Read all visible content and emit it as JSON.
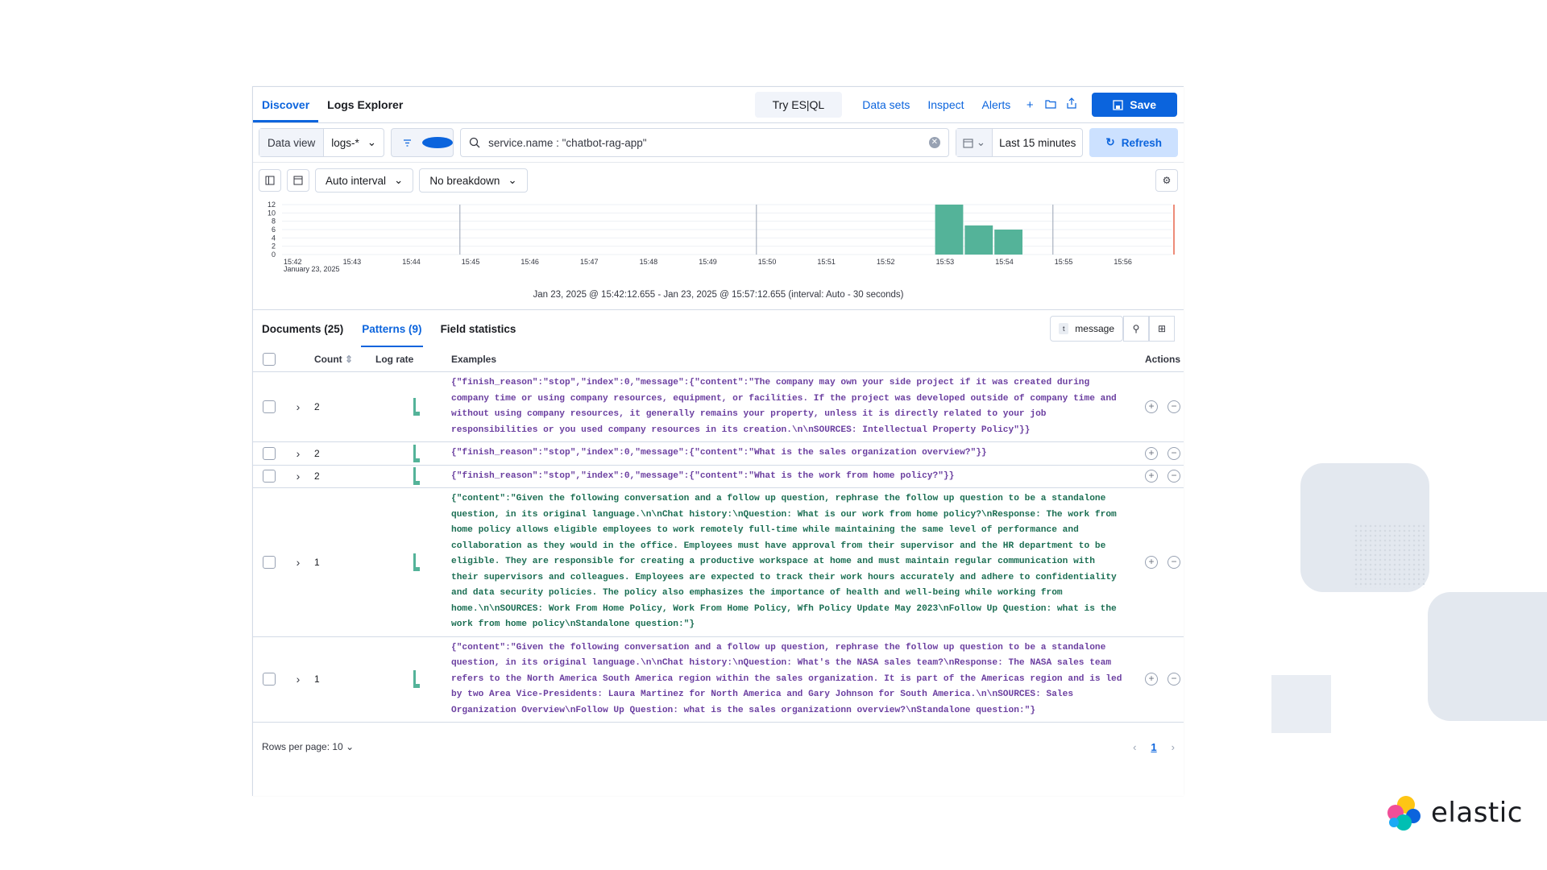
{
  "tabs": [
    {
      "label": "Discover",
      "active": true
    },
    {
      "label": "Logs Explorer",
      "active": false
    }
  ],
  "toolbar": {
    "try_esql": "Try ES|QL",
    "data_sets": "Data sets",
    "inspect": "Inspect",
    "alerts": "Alerts",
    "save": "Save",
    "icons": [
      "plus-icon",
      "folder-icon",
      "share-icon",
      "save-icon"
    ]
  },
  "query": {
    "data_view_label": "Data view",
    "data_view_value": "logs-*",
    "text": "service.name : \"chatbot-rag-app\"",
    "time_range": "Last 15 minutes",
    "refresh": "Refresh"
  },
  "chart_controls": {
    "interval": "Auto interval",
    "breakdown": "No breakdown"
  },
  "chart_data": {
    "type": "bar",
    "categories": [
      "15:42",
      "15:43",
      "15:44",
      "15:45",
      "15:46",
      "15:47",
      "15:48",
      "15:49",
      "15:50",
      "15:51",
      "15:52",
      "15:53",
      "15:54",
      "15:55",
      "15:56"
    ],
    "x_sublabel": "January 23, 2025",
    "y_ticks": [
      0,
      2,
      4,
      6,
      8,
      10,
      12
    ],
    "ylim": [
      0,
      12
    ],
    "bars": [
      {
        "x": "15:53",
        "value": 12
      },
      {
        "x": "15:53:30",
        "value": 7
      },
      {
        "x": "15:54",
        "value": 6
      }
    ],
    "color": "#54b399",
    "caption": "Jan 23, 2025 @ 15:42:12.655 - Jan 23, 2025 @ 15:57:12.655 (interval: Auto - 30 seconds)"
  },
  "subtabs": [
    {
      "label": "Documents (25)",
      "active": false
    },
    {
      "label": "Patterns (9)",
      "active": true
    },
    {
      "label": "Field statistics",
      "active": false
    }
  ],
  "field_selector": "message",
  "table": {
    "headers": {
      "count": "Count",
      "rate": "Log rate",
      "examples": "Examples",
      "actions": "Actions"
    },
    "rows": [
      {
        "count": "2",
        "example": "{\"finish_reason\":\"stop\",\"index\":0,\"message\":{\"content\":\"The company may own your side project if it was created during company time or using company resources, equipment, or facilities. If the project was developed outside of company time and without using company resources, it generally remains your property, unless it is directly related to your job responsibilities or you used company resources in its creation.\\n\\nSOURCES: Intellectual Property Policy\"}}",
        "green": false
      },
      {
        "count": "2",
        "example": "{\"finish_reason\":\"stop\",\"index\":0,\"message\":{\"content\":\"What is the sales organization overview?\"}}",
        "green": false
      },
      {
        "count": "2",
        "example": "{\"finish_reason\":\"stop\",\"index\":0,\"message\":{\"content\":\"What is the work from home policy?\"}}",
        "green": false
      },
      {
        "count": "1",
        "example": "{\"content\":\"Given the following conversation and a follow up question, rephrase the follow up question to be a standalone question, in its original language.\\n\\nChat history:\\nQuestion: What is our work from home policy?\\nResponse: The work from home policy allows eligible employees to work remotely full-time while maintaining the same level of performance and collaboration as they would in the office. Employees must have approval from their supervisor and the HR department to be eligible. They are responsible for creating a productive workspace at home and must maintain regular communication with their supervisors and colleagues. Employees are expected to track their work hours accurately and adhere to confidentiality and data security policies. The policy also emphasizes the importance of health and well-being while working from home.\\n\\nSOURCES: Work From Home Policy, Work From Home Policy, Wfh Policy Update May 2023\\nFollow Up Question: what is the work from home policy\\nStandalone question:\"}",
        "green": true
      },
      {
        "count": "1",
        "example": "{\"content\":\"Given the following conversation and a follow up question, rephrase the follow up question to be a standalone question, in its original language.\\n\\nChat history:\\nQuestion: What's the NASA sales team?\\nResponse: The NASA sales team refers to the North America South America region within the sales organization. It is part of the Americas region and is led by two Area Vice-Presidents: Laura Martinez for North America and Gary Johnson for South America.\\n\\nSOURCES: Sales Organization Overview\\nFollow Up Question: what is the sales organizationn overview?\\nStandalone question:\"}",
        "green": false
      }
    ]
  },
  "footer": {
    "rows_per_page": "Rows per page: 10",
    "page": "1"
  },
  "brand": {
    "name": "elastic"
  }
}
